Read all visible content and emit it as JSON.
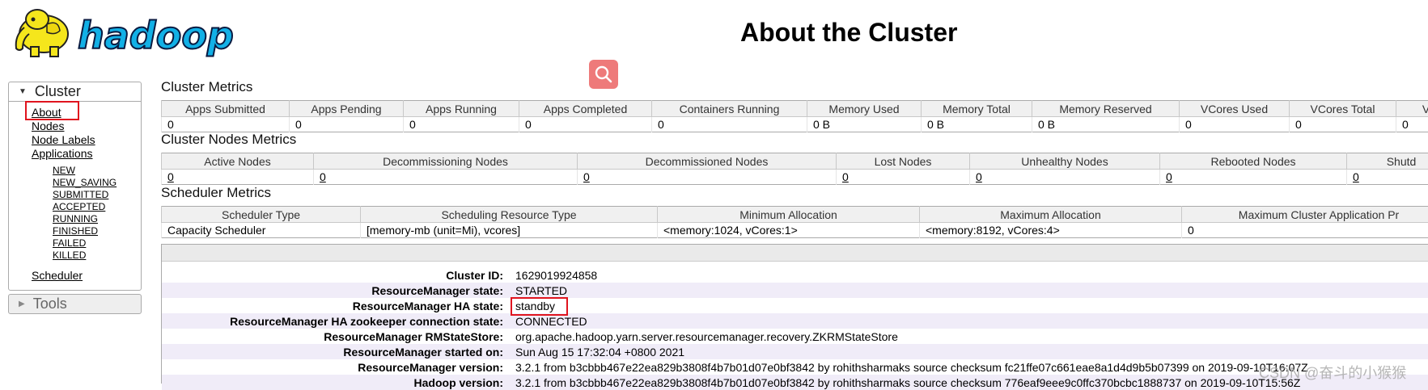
{
  "header": {
    "logo_text": "hadoop",
    "page_title": "About the Cluster"
  },
  "sidebar": {
    "cluster_label": "Cluster",
    "links": [
      "About",
      "Nodes",
      "Node Labels",
      "Applications"
    ],
    "app_states": [
      "NEW",
      "NEW_SAVING",
      "SUBMITTED",
      "ACCEPTED",
      "RUNNING",
      "FINISHED",
      "FAILED",
      "KILLED"
    ],
    "scheduler_label": "Scheduler",
    "tools_label": "Tools"
  },
  "cluster_metrics": {
    "title": "Cluster Metrics",
    "headers": [
      "Apps Submitted",
      "Apps Pending",
      "Apps Running",
      "Apps Completed",
      "Containers Running",
      "Memory Used",
      "Memory Total",
      "Memory Reserved",
      "VCores Used",
      "VCores Total",
      "V"
    ],
    "values": [
      "0",
      "0",
      "0",
      "0",
      "0",
      "0 B",
      "0 B",
      "0 B",
      "0",
      "0",
      "0"
    ]
  },
  "nodes_metrics": {
    "title": "Cluster Nodes Metrics",
    "headers": [
      "Active Nodes",
      "Decommissioning Nodes",
      "Decommissioned Nodes",
      "Lost Nodes",
      "Unhealthy Nodes",
      "Rebooted Nodes",
      "Shutd"
    ],
    "values": [
      "0",
      "0",
      "0",
      "0",
      "0",
      "0",
      "0"
    ]
  },
  "scheduler_metrics": {
    "title": "Scheduler Metrics",
    "headers": [
      "Scheduler Type",
      "Scheduling Resource Type",
      "Minimum Allocation",
      "Maximum Allocation",
      "Maximum Cluster Application Pr"
    ],
    "values": [
      "Capacity Scheduler",
      "[memory-mb (unit=Mi), vcores]",
      "<memory:1024, vCores:1>",
      "<memory:8192, vCores:4>",
      "0"
    ]
  },
  "cluster_info": [
    {
      "label": "Cluster ID:",
      "value": "1629019924858"
    },
    {
      "label": "ResourceManager state:",
      "value": "STARTED"
    },
    {
      "label": "ResourceManager HA state:",
      "value": "standby"
    },
    {
      "label": "ResourceManager HA zookeeper connection state:",
      "value": "CONNECTED"
    },
    {
      "label": "ResourceManager RMStateStore:",
      "value": "org.apache.hadoop.yarn.server.resourcemanager.recovery.ZKRMStateStore"
    },
    {
      "label": "ResourceManager started on:",
      "value": "Sun Aug 15 17:32:04 +0800 2021"
    },
    {
      "label": "ResourceManager version:",
      "value": "3.2.1 from b3cbbb467e22ea829b3808f4b7b01d07e0bf3842 by rohithsharmaks source checksum fc21ffe07c661eae8a1d4d9b5b07399 on 2019-09-10T16:07Z"
    },
    {
      "label": "Hadoop version:",
      "value": "3.2.1 from b3cbbb467e22ea829b3808f4b7b01d07e0bf3842 by rohithsharmaks source checksum 776eaf9eee9c0ffc370bcbc1888737 on 2019-09-10T15:56Z"
    }
  ],
  "watermark": "CSDN @奋斗的小猴猴",
  "colors": {
    "highlight": "#e0141e",
    "search_button": "#ee7a7a",
    "logo_yellow": "#f5e61c",
    "logo_blue": "#12b0e6"
  }
}
